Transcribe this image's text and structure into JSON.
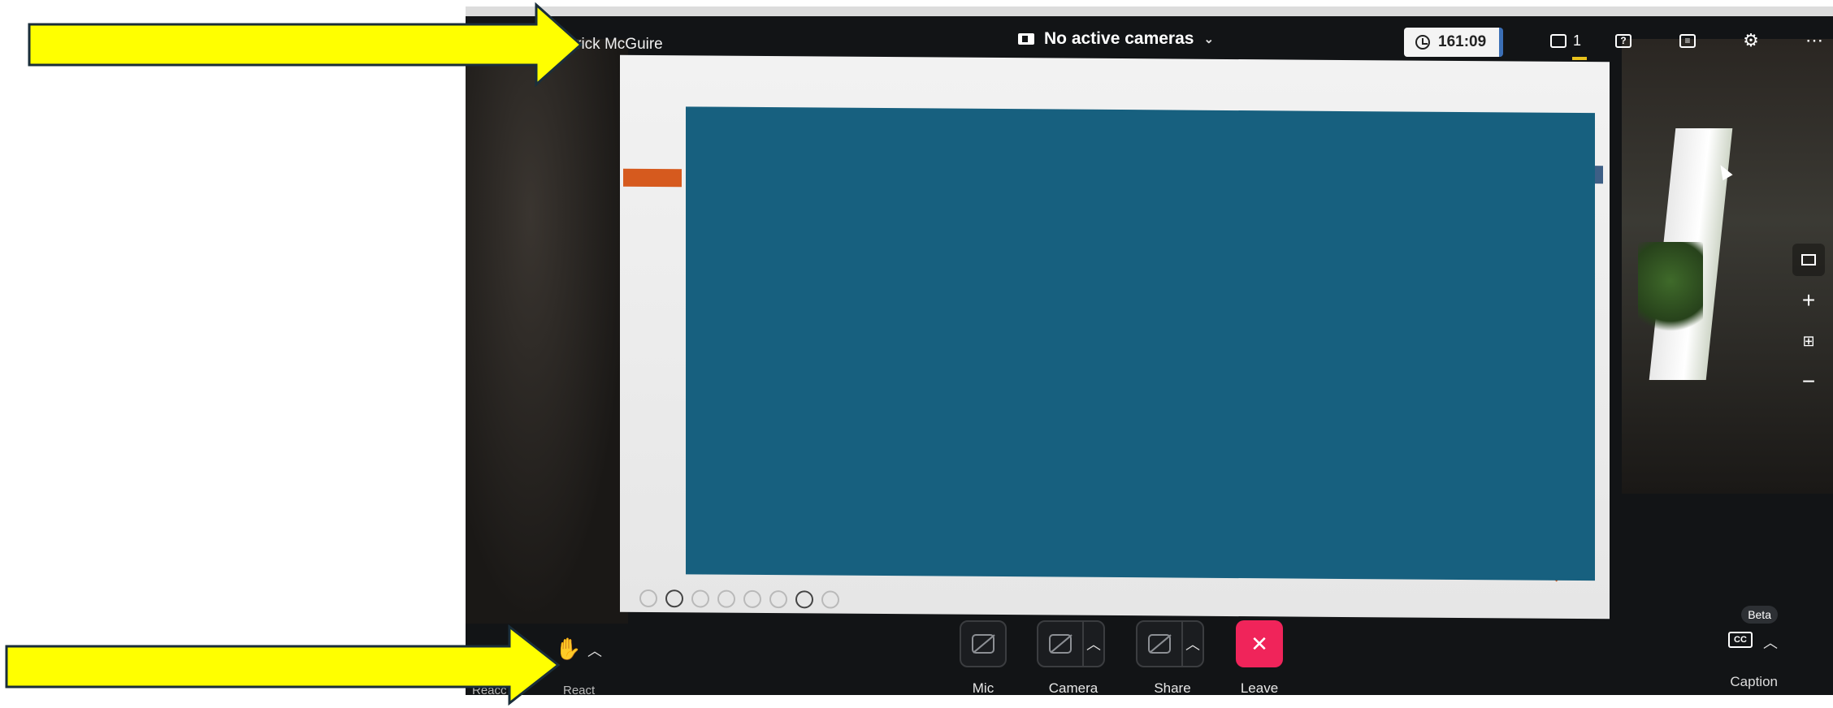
{
  "meeting": {
    "presenter_name": "derick McGuire",
    "camera_status": "No active cameras",
    "timer": "161:09",
    "chat_count": "1"
  },
  "icons": {
    "camera_status": "video-camera-icon",
    "camera_dropdown": "chevron-down-icon",
    "timer": "clock-icon",
    "chat": "chat-icon",
    "qa": "question-icon",
    "notes": "notes-icon",
    "settings": "gear-icon",
    "more": "ellipsis-icon",
    "raise_hand": "hand-icon"
  },
  "toolbar": {
    "mic_label": "Mic",
    "camera_label": "Camera",
    "share_label": "Share",
    "leave_label": "Leave",
    "caption_label": "Caption",
    "beta_badge": "Beta",
    "cc_text": "CC",
    "react_label": "React",
    "left_partial_label": "Reacc"
  },
  "colors": {
    "slide_blue": "#17607f",
    "leave_red": "#f0245a",
    "arrow_yellow": "#ffff00",
    "chat_highlight": "#e8c21c"
  }
}
